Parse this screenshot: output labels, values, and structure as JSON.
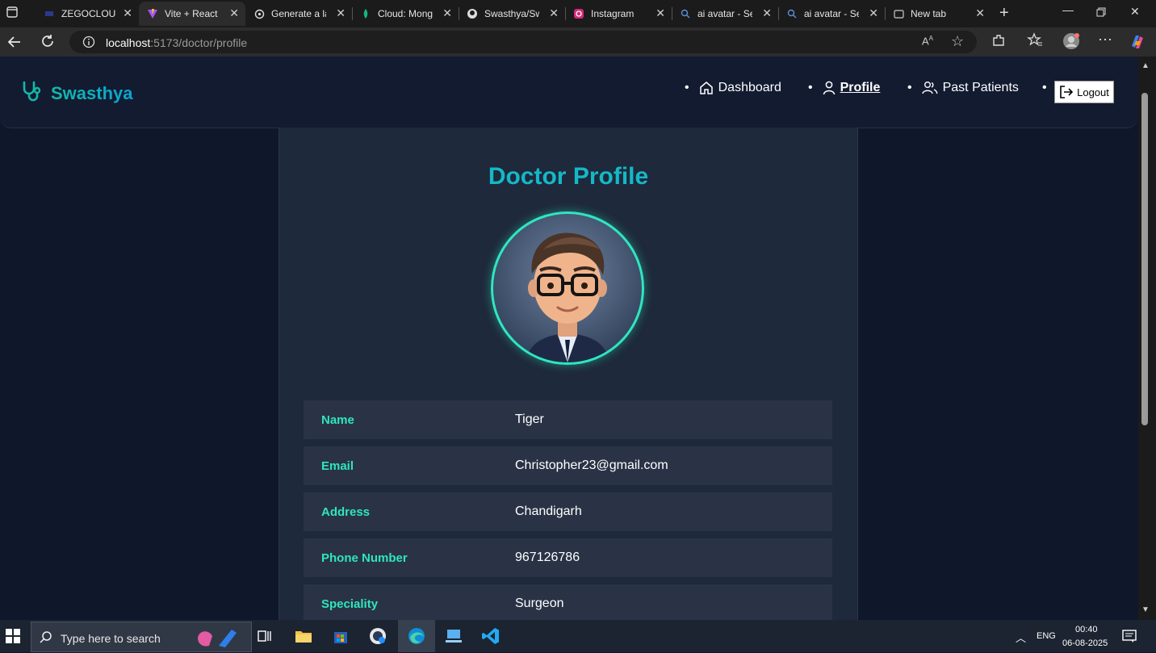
{
  "browser": {
    "tabs": [
      {
        "title": "ZEGOCLOUD C",
        "icon": "zegocloud-icon",
        "active": false
      },
      {
        "title": "Vite + React",
        "icon": "vite-icon",
        "active": true
      },
      {
        "title": "Generate a lan",
        "icon": "openai-icon",
        "active": false
      },
      {
        "title": "Cloud: Mongol",
        "icon": "mongodb-icon",
        "active": false
      },
      {
        "title": "Swasthya/Swa",
        "icon": "github-icon",
        "active": false
      },
      {
        "title": "Instagram",
        "icon": "instagram-icon",
        "active": false
      },
      {
        "title": "ai avatar - Sear",
        "icon": "search-icon",
        "active": false
      },
      {
        "title": "ai avatar - Sear",
        "icon": "search-icon",
        "active": false
      },
      {
        "title": "New tab",
        "icon": "newtab-icon",
        "active": false
      }
    ],
    "url_host": "localhost",
    "url_path": ":5173/doctor/profile"
  },
  "app": {
    "brand": "Swasthya",
    "nav": [
      {
        "label": "Dashboard",
        "icon": "home-icon",
        "active": false
      },
      {
        "label": "Profile",
        "icon": "user-icon",
        "active": true
      },
      {
        "label": "Past Patients",
        "icon": "users-icon",
        "active": false
      }
    ],
    "logout_label": "Logout"
  },
  "profile": {
    "title": "Doctor Profile",
    "fields": [
      {
        "label": "Name",
        "value": "Tiger"
      },
      {
        "label": "Email",
        "value": "Christopher23@gmail.com"
      },
      {
        "label": "Address",
        "value": "Chandigarh"
      },
      {
        "label": "Phone Number",
        "value": "967126786"
      },
      {
        "label": "Speciality",
        "value": "Surgeon"
      }
    ]
  },
  "taskbar": {
    "search_placeholder": "Type here to search",
    "lang": "ENG",
    "time": "00:40",
    "date": "06-08-2025"
  },
  "colors": {
    "accent": "#14b8c6",
    "label_green": "#2ee6c0",
    "page_bg": "#0f172a",
    "card_bg": "#1e293b",
    "row_bg": "#2a3346"
  }
}
